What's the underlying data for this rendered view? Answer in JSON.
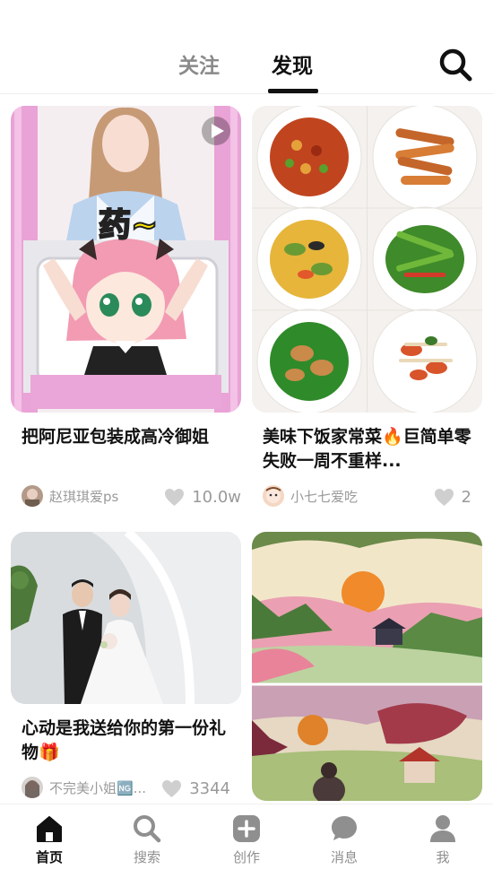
{
  "top_tabs": {
    "follow": "关注",
    "discover": "发现",
    "active": "discover"
  },
  "search_icon": "search-icon",
  "feed": {
    "cards": [
      {
        "title": "把阿尼亚包装成高冷御姐",
        "overlay_text": "药~",
        "is_video": true,
        "author": "赵琪琪爱ps",
        "likes": "10.0w"
      },
      {
        "title": "美味下饭家常菜🔥巨简单零失败一周不重样...",
        "author": "小七七爱吃",
        "likes": "2"
      },
      {
        "title": "心动是我送给你的第一份礼物🎁",
        "author": "不完美小姐🆖...",
        "likes": "3344"
      },
      {
        "title": "",
        "author": "",
        "likes": ""
      }
    ]
  },
  "bottom_nav": {
    "items": [
      {
        "label": "首页",
        "icon": "home-icon",
        "active": true
      },
      {
        "label": "搜索",
        "icon": "search-icon",
        "active": false
      },
      {
        "label": "创作",
        "icon": "plus-box-icon",
        "active": false
      },
      {
        "label": "消息",
        "icon": "chat-bubble-icon",
        "active": false
      },
      {
        "label": "我",
        "icon": "user-icon",
        "active": false
      }
    ]
  },
  "colors": {
    "active_text": "#111111",
    "inactive_text": "#8a8a8a",
    "meta_text": "#9a9a9a",
    "like_icon": "#cfcfcf",
    "nav_inactive_icon": "#8f8f8f"
  }
}
